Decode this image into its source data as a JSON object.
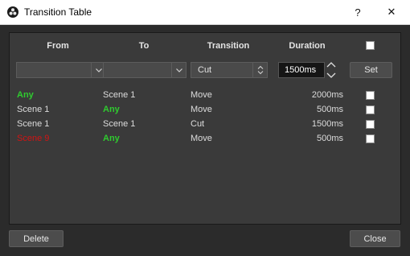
{
  "window": {
    "title": "Transition Table",
    "help": "?",
    "close": "✕",
    "icon": "obs-logo-icon"
  },
  "columns": {
    "from": "From",
    "to": "To",
    "transition": "Transition",
    "duration": "Duration"
  },
  "editor": {
    "from_value": "",
    "to_value": "",
    "transition_value": "Cut",
    "duration_value": "1500ms",
    "set_label": "Set"
  },
  "rows": [
    {
      "from": "Any",
      "to": "Scene 1",
      "transition": "Move",
      "duration": "2000ms"
    },
    {
      "from": "Scene 1",
      "to": "Any",
      "transition": "Move",
      "duration": "500ms"
    },
    {
      "from": "Scene 1",
      "to": "Scene 1",
      "transition": "Cut",
      "duration": "1500ms"
    },
    {
      "from": "Scene 9",
      "to": "Any",
      "transition": "Move",
      "duration": "500ms"
    }
  ],
  "footer": {
    "delete_label": "Delete",
    "close_label": "Close"
  },
  "colors": {
    "any": "#2fcb2f",
    "invalid": "#d01414",
    "background": "#2b2b2b",
    "panel": "#3a3a3a"
  }
}
